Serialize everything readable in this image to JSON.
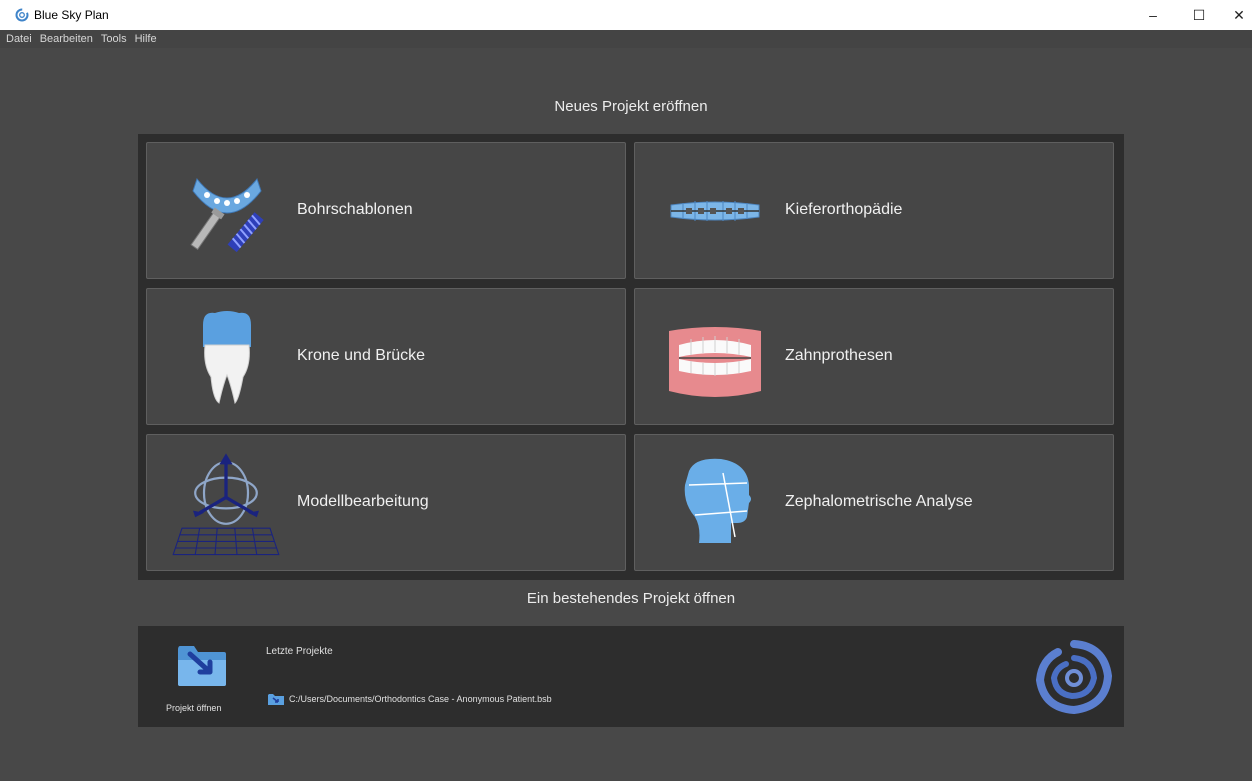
{
  "window": {
    "title": "Blue Sky Plan",
    "minimize": "–",
    "maximize": "☐",
    "close": "✕"
  },
  "menu": [
    "Datei",
    "Bearbeiten",
    "Tools",
    "Hilfe"
  ],
  "new_project": {
    "heading": "Neues Projekt eröffnen",
    "cards": [
      {
        "label": "Bohrschablonen",
        "icon": "surgical-guide-icon"
      },
      {
        "label": "Kieferorthopädie",
        "icon": "braces-icon"
      },
      {
        "label": "Krone und Brücke",
        "icon": "tooth-crown-icon"
      },
      {
        "label": "Zahnprothesen",
        "icon": "dentures-icon"
      },
      {
        "label": "Modellbearbeitung",
        "icon": "model-editing-icon"
      },
      {
        "label": "Zephalometrische Analyse",
        "icon": "head-profile-icon"
      }
    ]
  },
  "open_project": {
    "heading": "Ein bestehendes Projekt öffnen",
    "open_label": "Projekt öffnen",
    "recent_title": "Letzte Projekte",
    "recent": [
      "C:/Users/Documents/Orthodontics Case - Anonymous Patient.bsb"
    ]
  },
  "colors": {
    "background": "#484848",
    "panel": "#2d2d2d",
    "card": "#464646",
    "accent_blue": "#5a9fd8"
  }
}
